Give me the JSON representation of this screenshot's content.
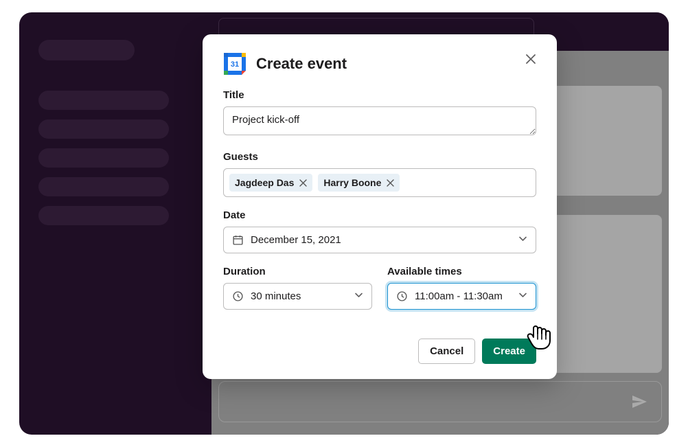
{
  "modal": {
    "title": "Create event",
    "title_label": "Title",
    "title_value": "Project kick-off",
    "guests_label": "Guests",
    "guests": [
      {
        "name": "Jagdeep Das"
      },
      {
        "name": "Harry Boone"
      }
    ],
    "date_label": "Date",
    "date_value": "December 15, 2021",
    "duration_label": "Duration",
    "duration_value": "30 minutes",
    "available_label": "Available times",
    "available_value": "11:00am - 11:30am",
    "cancel_label": "Cancel",
    "create_label": "Create",
    "calendar_day": "31"
  }
}
